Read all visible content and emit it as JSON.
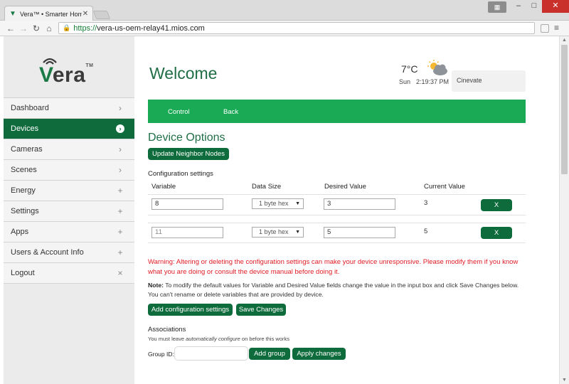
{
  "browser": {
    "tab_title": "Vera™ • Smarter Home C",
    "url_scheme": "https://",
    "url_host": "vera-us-oem-relay41.mios.com"
  },
  "sidebar": {
    "logo_text": "era",
    "logo_letter": "V",
    "logo_tm": "TM",
    "items": [
      {
        "label": "Dashboard",
        "indicator": "›"
      },
      {
        "label": "Devices",
        "indicator": "›"
      },
      {
        "label": "Cameras",
        "indicator": "›"
      },
      {
        "label": "Scenes",
        "indicator": "›"
      },
      {
        "label": "Energy",
        "indicator": "+"
      },
      {
        "label": "Settings",
        "indicator": "+"
      },
      {
        "label": "Apps",
        "indicator": "+"
      },
      {
        "label": "Users & Account Info",
        "indicator": "+"
      },
      {
        "label": "Logout",
        "indicator": "×"
      }
    ]
  },
  "header": {
    "welcome": "Welcome",
    "temperature": "7°C",
    "day": "Sun",
    "time": "2:19:37 PM",
    "house_name": "Cinevate"
  },
  "greenbar": {
    "control": "Control",
    "back": "Back"
  },
  "device_options": {
    "title": "Device Options",
    "update_neighbor_nodes": "Update Neighbor Nodes",
    "config_settings_label": "Configuration settings",
    "columns": {
      "variable": "Variable",
      "data_size": "Data Size",
      "desired_value": "Desired Value",
      "current_value": "Current Value"
    },
    "rows": [
      {
        "variable": "8",
        "data_size": "1 byte hex",
        "desired": "3",
        "current": "3",
        "delete": "X"
      },
      {
        "variable": "11",
        "data_size": "1 byte hex",
        "desired": "5",
        "current": "5",
        "delete": "X"
      }
    ],
    "warning": "Warning: Altering or deleting the configuration settings can make your device unresponsive. Please modify them if you know what you are doing or consult the device manual before doing it.",
    "note_label": "Note:",
    "note_text": " To modify the default values for Variable and Desired Value fields change the value in the input box and click Save Changes below. You can't rename or delete variables that are provided by device.",
    "add_config": "Add configuration settings",
    "save_changes": "Save Changes"
  },
  "associations": {
    "title": "Associations",
    "hint_prefix": "You must leave ",
    "hint_em": "automatically configure",
    "hint_suffix": " on before this works",
    "group_id_label": "Group ID:",
    "group_id_value": "",
    "add_group": "Add group",
    "apply_changes": "Apply changes"
  },
  "colors": {
    "brand_green": "#0f6b3c",
    "bar_green": "#1aaa55",
    "warning_red": "#e01b24"
  }
}
